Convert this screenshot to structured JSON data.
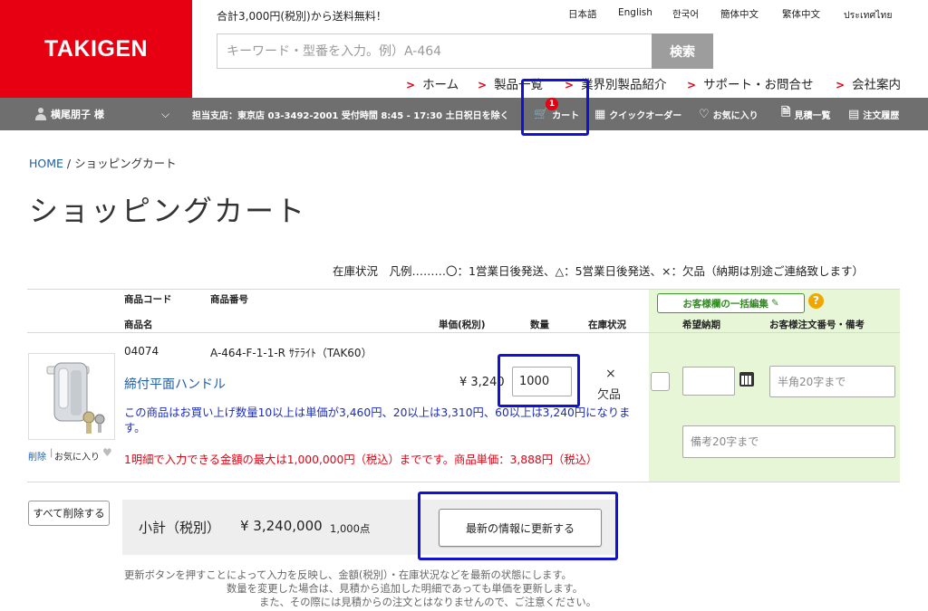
{
  "header": {
    "logo_text": "TAKIGEN",
    "promo": "合計3,000円(税別)から送料無料！",
    "languages": [
      "日本語",
      "English",
      "한국어",
      "簡体中文",
      "繁体中文",
      "ประเทศไทย"
    ],
    "search": {
      "placeholder": "キーワード・型番を入力。例）A-464",
      "button_label": "検索"
    },
    "nav": [
      "ホーム",
      "製品一覧",
      "業界別製品紹介",
      "サポート・お問合せ",
      "会社案内"
    ]
  },
  "user_bar": {
    "user_name": "横尾朋子 様",
    "branch_info": "担当支店：東京店 03-3492-2001 受付時間 8:45 - 17:30 土日祝日を除く",
    "cart_label": "カート",
    "cart_count": "1",
    "quick_order": "クイックオーダー",
    "favorites": "お気に入り",
    "quotes": "見積一覧",
    "order_history": "注文履歴"
  },
  "breadcrumb": {
    "home": "HOME",
    "sep": " / ",
    "current": "ショッピングカート"
  },
  "page_title": "ショッピングカート",
  "stock_legend": "在庫状況　凡例………〇：1営業日後発送、△：5営業日後発送、×：欠品（納期は別途ご連絡致します）",
  "table": {
    "headers": {
      "product_code": "商品コード",
      "product_number": "商品番号",
      "product_name": "商品名",
      "unit_price": "単価(税別)",
      "quantity": "数量",
      "stock": "在庫状況",
      "bulk_edit": "お客様欄の一括編集",
      "delivery_date": "希望納期",
      "order_number": "お客様注文番号・備考"
    },
    "item": {
      "code": "04074",
      "number": "A-464-F-1-1-R ｻﾃﾗｲﾄ（TAK60）",
      "name": "締付平面ハンドル",
      "unit_price": "¥ 3,240",
      "quantity": "1000",
      "stock_symbol": "×",
      "stock_text": "欠品",
      "volume_notice": "この商品はお買い上げ数量10以上は単価が3,460円、20以上は3,310円、60以上は3,240円になります。",
      "limit_notice": "1明細で入力できる金額の最大は1,000,000円（税込）までです。商品単価：3,888円（税込）",
      "remove_label": "削除",
      "favorite_label": "お気に入り",
      "order_number_placeholder": "半角20字まで",
      "remarks_placeholder": "備考20字まで"
    }
  },
  "summary": {
    "delete_all": "すべて削除する",
    "subtotal_label": "小計（税別）",
    "subtotal_value": "¥ 3,240,000",
    "points": "1,000点",
    "refresh_button": "最新の情報に更新する",
    "notes": [
      "更新ボタンを押すことによって入力を反映し、金額(税別）・在庫状況などを最新の状態にします。",
      "数量を変更した場合は、見積から追加した明細であっても単価を更新します。",
      "また、その際には見積からの注文とはなりませんので、ご注意ください。"
    ]
  },
  "colors": {
    "brand_red": "#e60012",
    "link_blue": "#1d5ea8",
    "highlight_blue": "#1212d6",
    "panel_green": "#e7f6d6"
  }
}
